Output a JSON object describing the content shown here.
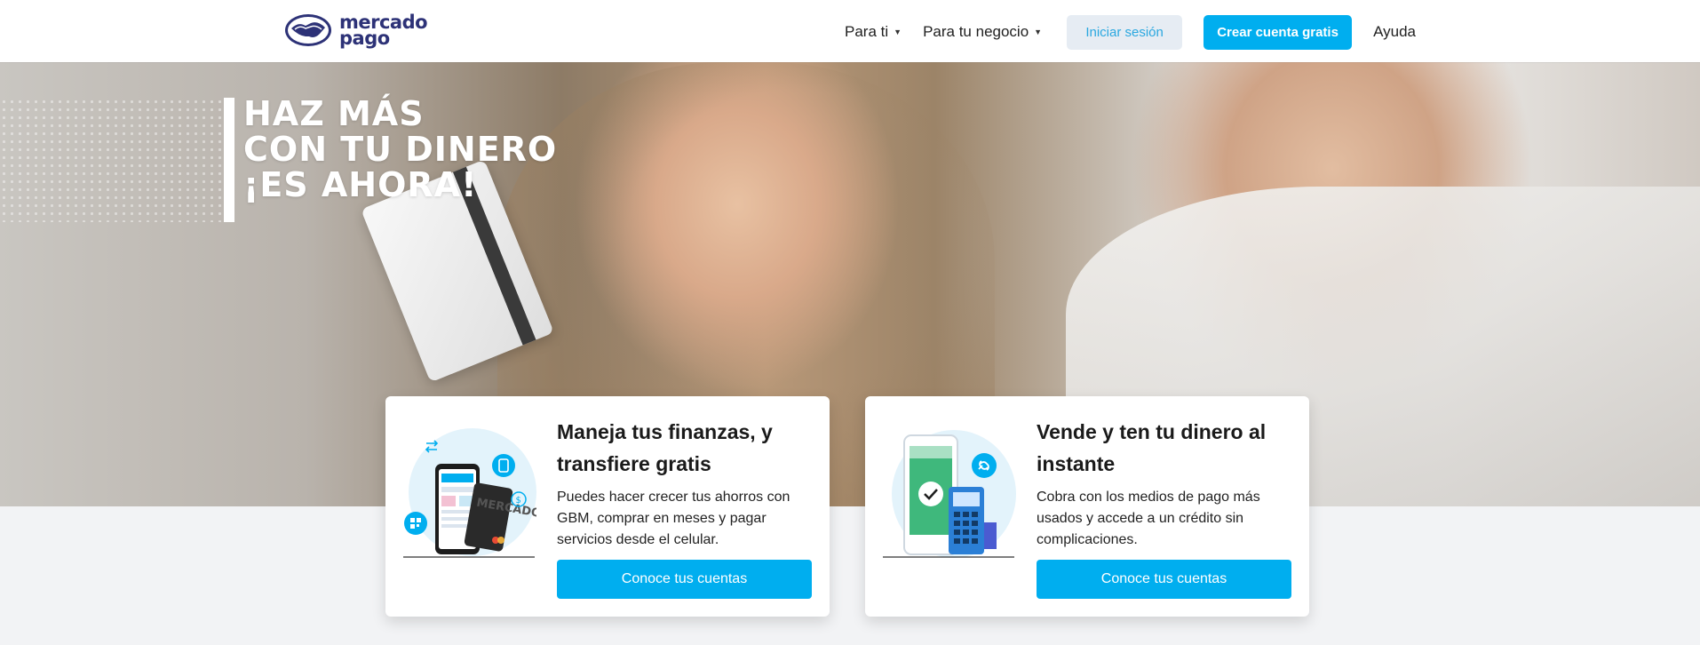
{
  "header": {
    "logo": {
      "line1": "mercado",
      "line2": "pago"
    },
    "nav": [
      {
        "label": "Para ti"
      },
      {
        "label": "Para tu negocio"
      }
    ],
    "login_label": "Iniciar sesión",
    "create_label": "Crear cuenta gratis",
    "help_label": "Ayuda"
  },
  "hero": {
    "headline": [
      "HAZ MÁS",
      "CON TU DINERO",
      "¡ES AHORA!"
    ]
  },
  "cards": [
    {
      "title": "Maneja tus finanzas, y transfiere gratis",
      "text": "Puedes hacer crecer tus ahorros con GBM, comprar en meses y pagar servicios desde el celular.",
      "button": "Conoce tus cuentas",
      "illustration_label": "MERCADO PAGO"
    },
    {
      "title": "Vende y ten tu dinero al instante",
      "text": "Cobra con los medios de pago más usados y accede a un crédito sin complicaciones.",
      "button": "Conoce tus cuentas"
    }
  ],
  "colors": {
    "primary": "#00aeef",
    "brand_dark": "#2d3277",
    "login_bg": "#e6ecf3",
    "page_bg": "#f2f3f5"
  },
  "icons": [
    "handshake-logo-icon",
    "caret-down-icon",
    "transfer-icon",
    "qr-icon",
    "phone-icon",
    "dollar-icon",
    "link-icon",
    "check-icon"
  ]
}
